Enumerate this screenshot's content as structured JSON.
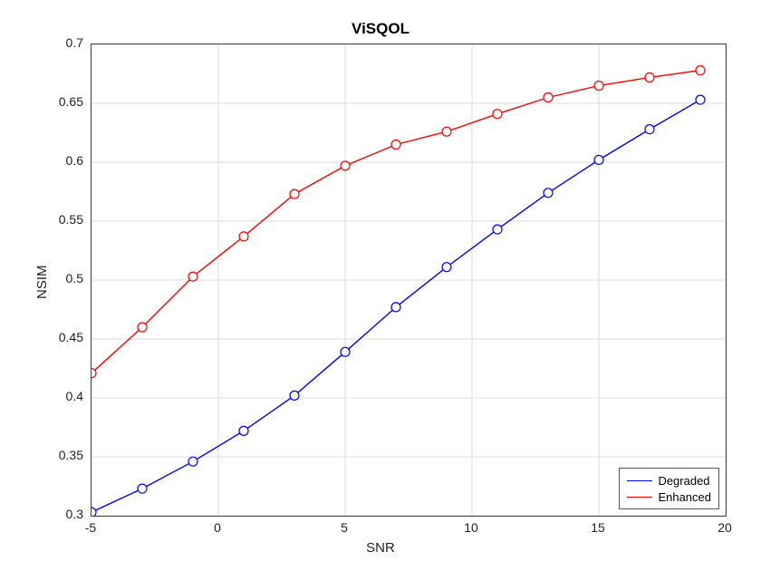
{
  "chart_data": {
    "type": "line",
    "title": "ViSQOL",
    "xlabel": "SNR",
    "ylabel": "NSIM",
    "xlim": [
      -5,
      20
    ],
    "ylim": [
      0.3,
      0.7
    ],
    "xticks": [
      -5,
      0,
      5,
      10,
      15,
      20
    ],
    "yticks": [
      0.3,
      0.35,
      0.4,
      0.45,
      0.5,
      0.55,
      0.6,
      0.65,
      0.7
    ],
    "x": [
      -5,
      -3,
      -1,
      1,
      3,
      5,
      7,
      9,
      11,
      13,
      15,
      17,
      19
    ],
    "series": [
      {
        "name": "Degraded",
        "color": "#0000ff",
        "values": [
          0.303,
          0.323,
          0.346,
          0.372,
          0.402,
          0.439,
          0.477,
          0.511,
          0.543,
          0.574,
          0.602,
          0.628,
          0.653
        ]
      },
      {
        "name": "Enhanced",
        "color": "#ff0000",
        "values": [
          0.421,
          0.46,
          0.503,
          0.537,
          0.573,
          0.597,
          0.615,
          0.626,
          0.641,
          0.655,
          0.665,
          0.672,
          0.678
        ]
      }
    ],
    "legend_position": "bottom-right",
    "grid": true
  }
}
